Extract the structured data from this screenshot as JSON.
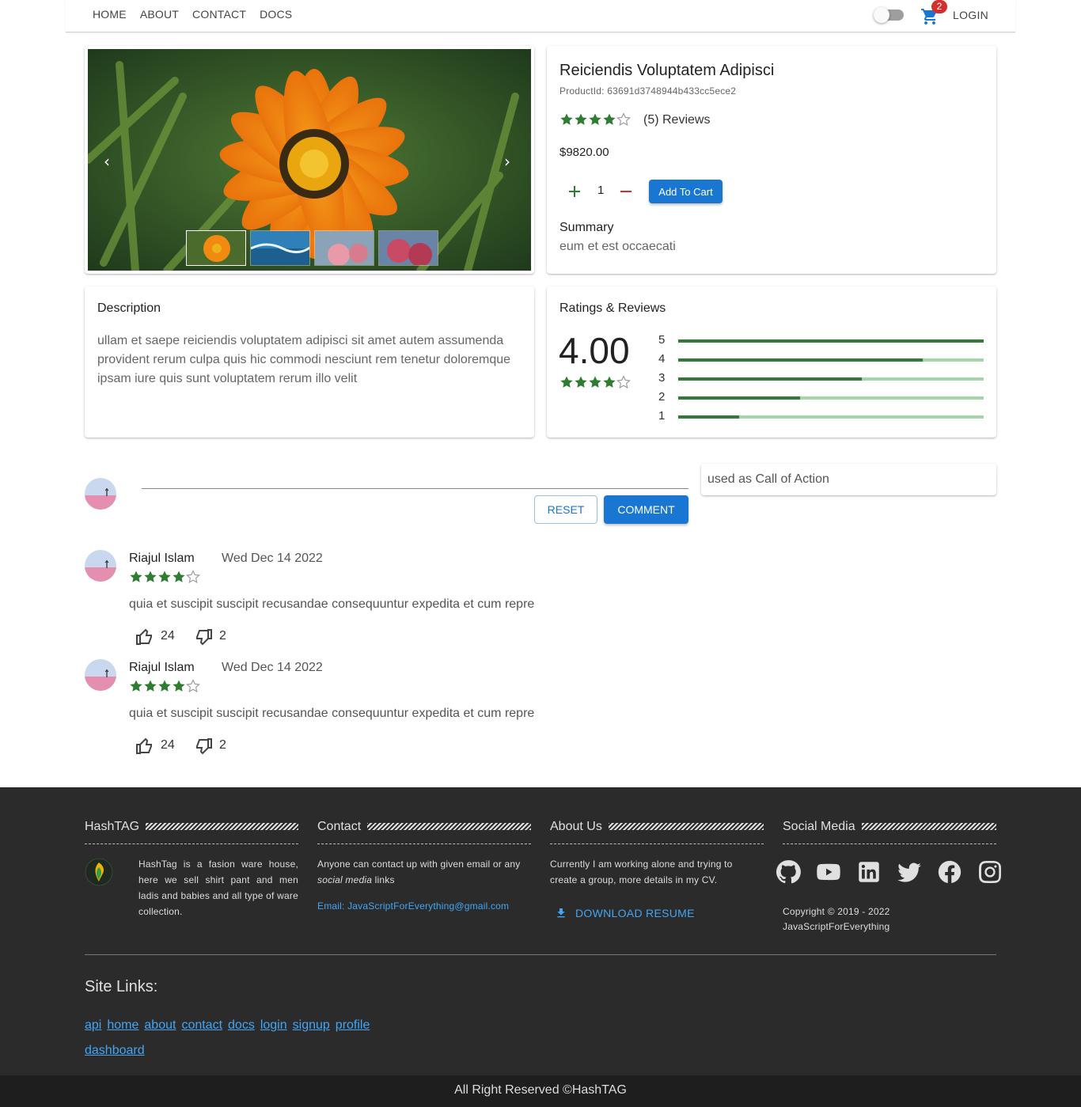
{
  "nav": {
    "links": [
      "HOME",
      "ABOUT",
      "CONTACT",
      "DOCS"
    ],
    "cart_count": "2",
    "login_label": "LOGIN",
    "theme_toggle": "off"
  },
  "gallery": {
    "prev_icon": "chevron-left-icon",
    "next_icon": "chevron-right-icon",
    "thumbnails": [
      "orange-flower",
      "ocean-wave",
      "pink-blossom",
      "red-blossom"
    ]
  },
  "product": {
    "title": "Reiciendis Voluptatem Adipisci",
    "product_id": "ProductId: 63691d3748944b433cc5ece2",
    "rating": 4,
    "reviews_label": "(5) Reviews",
    "price": "$9820.00",
    "quantity": "1",
    "add_to_cart_label": "Add To Cart",
    "summary_label": "Summary",
    "summary_text": "eum et est occaecati"
  },
  "description": {
    "title": "Description",
    "text": "ullam et saepe reiciendis voluptatem adipisci sit amet autem assumenda provident rerum culpa quis hic commodi nesciunt rem tenetur doloremque ipsam iure quis sunt voluptatem rerum illo velit"
  },
  "ratings": {
    "title": "Ratings & Reviews",
    "average": "4.00",
    "average_stars": 4,
    "breakdown": [
      {
        "label": "5",
        "fraction": 1.0
      },
      {
        "label": "4",
        "fraction": 0.8
      },
      {
        "label": "3",
        "fraction": 0.6
      },
      {
        "label": "2",
        "fraction": 0.4
      },
      {
        "label": "1",
        "fraction": 0.2
      }
    ]
  },
  "composer": {
    "reset_label": "RESET",
    "comment_label": "COMMENT",
    "cta_text": "used as Call of Action"
  },
  "reviews": [
    {
      "name": "Riajul Islam",
      "date": "Wed Dec 14 2022",
      "stars": 4,
      "text": "quia et suscipit suscipit recusandae consequuntur expedita et cum repre",
      "likes": "24",
      "dislikes": "2"
    },
    {
      "name": "Riajul Islam",
      "date": "Wed Dec 14 2022",
      "stars": 4,
      "text": "quia et suscipit suscipit recusandae consequuntur expedita et cum repre",
      "likes": "24",
      "dislikes": "2"
    }
  ],
  "footer": {
    "hashtag": {
      "title": "HashTAG",
      "text": "HashTag is a fasion ware house, here we sell shirt pant and men ladis and babies and all type of ware collection."
    },
    "contact": {
      "title": "Contact",
      "text_before": "Anyone can contact up with given email or any ",
      "text_em": "social media",
      "text_after": " links",
      "email": "Email: JavaScriptForEverything@gmail.com"
    },
    "about": {
      "title": "About Us",
      "text": "Currently I am working alone and trying to create a group, more details in my CV.",
      "download_label": "DOWNLOAD RESUME"
    },
    "social": {
      "title": "Social Media",
      "icons": [
        "github-icon",
        "youtube-icon",
        "linkedin-icon",
        "twitter-icon",
        "facebook-icon",
        "instagram-icon"
      ],
      "copyright_line1": "Copyright © 2019 - 2022",
      "copyright_line2": "JavaScriptForEverything"
    },
    "site_links_title": "Site Links:",
    "site_links": [
      "api",
      "home",
      "about",
      "contact",
      "docs",
      "login",
      "signup",
      "profile",
      "dashboard"
    ],
    "bottom_text": "All Right Reserved ©HashTAG"
  },
  "colors": {
    "primary": "#1976d2",
    "star_green": "#2e7d32",
    "bar_track": "#a5d6a7",
    "footer_bg": "#2b2b2b",
    "link_blue": "#42a5f5",
    "badge_red": "#d32f2f"
  }
}
